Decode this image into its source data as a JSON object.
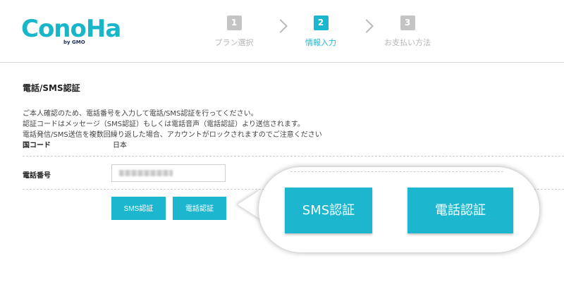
{
  "header": {
    "logo_text": "ConoHa",
    "logo_sub": "by GMO",
    "steps": [
      {
        "num": "1",
        "label": "プラン選択"
      },
      {
        "num": "2",
        "label": "情報入力"
      },
      {
        "num": "3",
        "label": "お支払い方法"
      }
    ],
    "active_step": 2
  },
  "main": {
    "title": "電話/SMS認証",
    "description": [
      "ご本人確認のため、電話番号を入力して電話/SMS認証を行ってください。",
      "認証コードはメッセージ（SMS認証）もしくは電話音声（電話認証）より送信されます。",
      "電話発信/SMS送信を複数回繰り返した場合、アカウントがロックされますのでご注意ください"
    ],
    "country_label": "国コード",
    "country_value": "日本",
    "phone_label": "電話番号",
    "sms_button": "SMS認証",
    "call_button": "電話認証"
  },
  "callout": {
    "sms_button": "SMS認証",
    "call_button": "電話認証"
  },
  "colors": {
    "accent": "#1cb7cf",
    "inactive_step": "#c4c4c4"
  }
}
